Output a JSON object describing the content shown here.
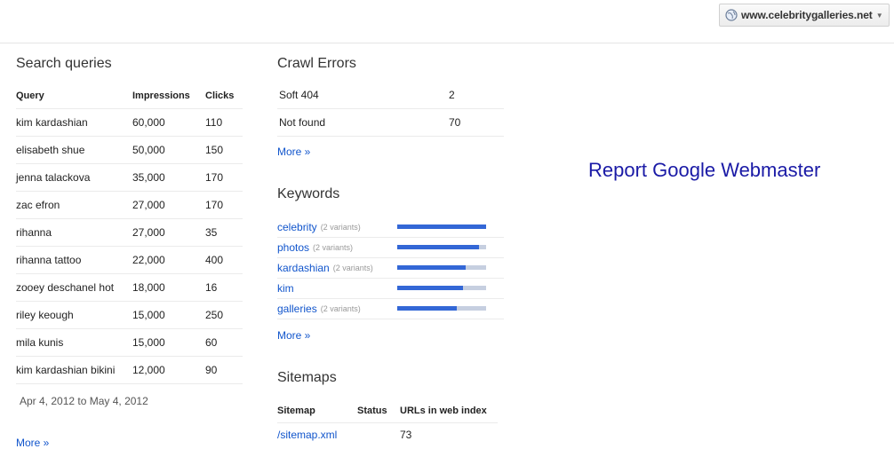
{
  "header": {
    "site": "www.celebritygalleries.net"
  },
  "search_queries": {
    "title": "Search queries",
    "columns": [
      "Query",
      "Impressions",
      "Clicks"
    ],
    "rows": [
      [
        "kim kardashian",
        "60,000",
        "110"
      ],
      [
        "elisabeth shue",
        "50,000",
        "150"
      ],
      [
        "jenna talackova",
        "35,000",
        "170"
      ],
      [
        "zac efron",
        "27,000",
        "170"
      ],
      [
        "rihanna",
        "27,000",
        "35"
      ],
      [
        "rihanna tattoo",
        "22,000",
        "400"
      ],
      [
        "zooey deschanel hot",
        "18,000",
        "16"
      ],
      [
        "riley keough",
        "15,000",
        "250"
      ],
      [
        "mila kunis",
        "15,000",
        "60"
      ],
      [
        "kim kardashian bikini",
        "12,000",
        "90"
      ]
    ],
    "date_range": "Apr 4, 2012 to May 4, 2012",
    "more": "More »"
  },
  "crawl_errors": {
    "title": "Crawl Errors",
    "rows": [
      [
        "Soft 404",
        "2"
      ],
      [
        "Not found",
        "70"
      ]
    ],
    "more": "More »"
  },
  "keywords": {
    "title": "Keywords",
    "items": [
      {
        "keyword": "celebrity",
        "variants": "(2 variants)",
        "level": 1.0
      },
      {
        "keyword": "photos",
        "variants": "(2 variants)",
        "level": 0.92
      },
      {
        "keyword": "kardashian",
        "variants": "(2 variants)",
        "level": 0.77
      },
      {
        "keyword": "kim",
        "variants": "",
        "level": 0.74
      },
      {
        "keyword": "galleries",
        "variants": "(2 variants)",
        "level": 0.67
      }
    ],
    "more": "More »"
  },
  "sitemaps": {
    "title": "Sitemaps",
    "columns": [
      "Sitemap",
      "Status",
      "URLs in web index"
    ],
    "rows": [
      [
        "/sitemap.xml",
        "",
        "73"
      ]
    ]
  },
  "report_title": "Report Google Webmaster",
  "colors": {
    "link": "#1155cc",
    "bar_fill": "#3367d6",
    "bar_track": "#c6cfe0",
    "report_title": "#1a1aa6"
  }
}
